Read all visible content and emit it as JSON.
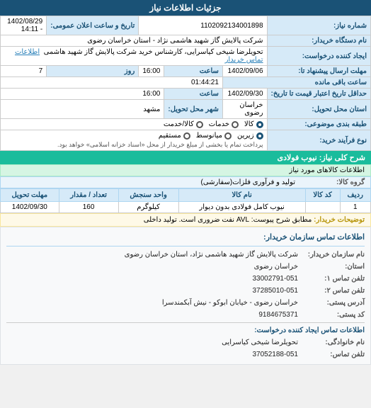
{
  "header": {
    "title": "جزئیات اطلاعات نیاز"
  },
  "info_section": {
    "title": "جزئیات اطلاعات نیاز",
    "fields": {
      "number_label": "شماره نیاز:",
      "number_value": "1102092134001898",
      "datetime_label": "تاریخ و ساعت اعلان عمومی:",
      "datetime_value": "1402/08/29 - 14:11",
      "buyer_company_label": "نام دستگاه خریدار:",
      "buyer_company_value": "شرکت پالایش گاز شهید هاشمی نژاد - استان خراسان رضوی",
      "requester_label": "ایجاد کننده درخواست:",
      "requester_value": "تحویلرضا شیخی کیاسرایی، کارشناس خرید شرکت پالایش گاز شهید هاشمی",
      "requester_link": "اطلاعات تماس خریدار",
      "send_date_label": "مهلت ارسال پیشنهاد تا:",
      "send_date_value": "1402/09/06",
      "send_time_label": "ساعت",
      "send_time_value": "16:00",
      "send_day_label": "روز",
      "send_day_value": "7",
      "send_remain_label": "ساعت باقی مانده",
      "send_remain_value": "01:44:21",
      "open_date_label": "حداقل تاریخ اعتبار قیمت تا تاریخ:",
      "open_date_value": "1402/09/30",
      "open_time_label": "ساعت",
      "open_time_value": "16:00",
      "province_label": "استان محل تحویل:",
      "province_value": "خراسان رضوی",
      "city_label": "شهر محل تحویل:",
      "city_value": "مشهد",
      "category_label": "طبقه بندی موضوعی:",
      "category_options": [
        "کالا",
        "خدمات",
        "کالا/خدمت"
      ],
      "category_selected": "کالا",
      "buy_type_label": "نوع فرآیند خرید:",
      "buy_type_options": [
        "زیرین",
        "میانوسط",
        "مستقیم"
      ],
      "buy_type_selected": "زیرین",
      "buy_note": "پرداخت تمام یا بخشی از مبلغ خریدار از محل «اسناد خزانه اسلامی» خواهد بود."
    }
  },
  "goods_section": {
    "title": "شرح کلی نیاز: نیوب فولادی",
    "subtitle": "اطلاعات کالاهای مورد نیاز",
    "group_label": "گروه کالا:",
    "group_value": "تولید و فرآوری فلزات(سفارشی)",
    "table_headers": [
      "ردیف",
      "کد کالا",
      "نام کالا",
      "واحد سنجش",
      "تعداد / مقدار",
      "مهلت تحویل"
    ],
    "table_rows": [
      {
        "row": "1",
        "code": "",
        "name": "نیوب کامل فولادی بدون دیوار",
        "unit": "کیلوگرم",
        "qty": "160",
        "deadline": "1402/09/30"
      }
    ]
  },
  "notes_section": {
    "label": "توضیحات خریدار:",
    "text": "مطابق شرح پیوست: AVL نفت ضروری است. تولید داخلی"
  },
  "contact_section": {
    "title": "اطلاعات تماس سازمان خریدار:",
    "buyer_name_label": "نام سازمان خریدار:",
    "buyer_name_value": "شرکت پالایش گاز شهید هاشمی نژاد، استان خراسان رضوی",
    "province_label": "استان:",
    "province_value": "خراسان رضوی",
    "phone1_label": "تلفن تماس ۱:",
    "phone1_value": "33002791-051",
    "phone2_label": "تلفن تماس ۲:",
    "phone2_value": "37285010-051",
    "address_label": "آدرس پستی:",
    "address_value": "خراسان رضوی - خیابان ابوکو - نیش آبکمندسرا",
    "postal_label": "کد پستی:",
    "postal_value": "9184675371",
    "contact_info_label": "اطلاعات تماس ایجاد کننده درخواست:",
    "contact_name_label": "نام خانوادگی:",
    "contact_name_value": "تحویلرضا شیخی کیاسرایی",
    "contact_phone_label": "تلفن تماس:",
    "contact_phone_value": "37052188-051"
  }
}
